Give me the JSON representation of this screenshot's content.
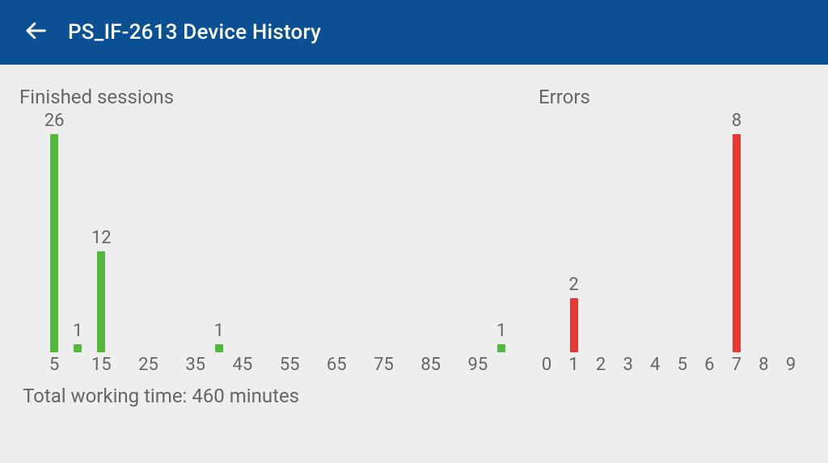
{
  "header": {
    "title": "PS_IF-2613  Device History",
    "back_icon": "back-arrow-icon"
  },
  "sections": {
    "finished": {
      "title": "Finished sessions",
      "footer": "Total working time: 460 minutes"
    },
    "errors": {
      "title": "Errors"
    }
  },
  "chart_data": [
    {
      "id": "finished",
      "type": "bar",
      "title": "Finished sessions",
      "color": "#55b83e",
      "x_ticks": [
        5,
        15,
        25,
        35,
        45,
        55,
        65,
        75,
        85,
        95
      ],
      "points": [
        {
          "x": 5,
          "value": 26
        },
        {
          "x": 10,
          "value": 1
        },
        {
          "x": 15,
          "value": 12
        },
        {
          "x": 40,
          "value": 1
        },
        {
          "x": 100,
          "value": 1
        }
      ],
      "x_range": [
        0,
        100
      ],
      "ylim": [
        0,
        26
      ]
    },
    {
      "id": "errors",
      "type": "bar",
      "title": "Errors",
      "color": "#e53935",
      "x_ticks": [
        0,
        1,
        2,
        3,
        4,
        5,
        6,
        7,
        8,
        9
      ],
      "points": [
        {
          "x": 1,
          "value": 2
        },
        {
          "x": 7,
          "value": 8
        }
      ],
      "x_range": [
        0,
        9
      ],
      "ylim": [
        0,
        8
      ]
    }
  ]
}
